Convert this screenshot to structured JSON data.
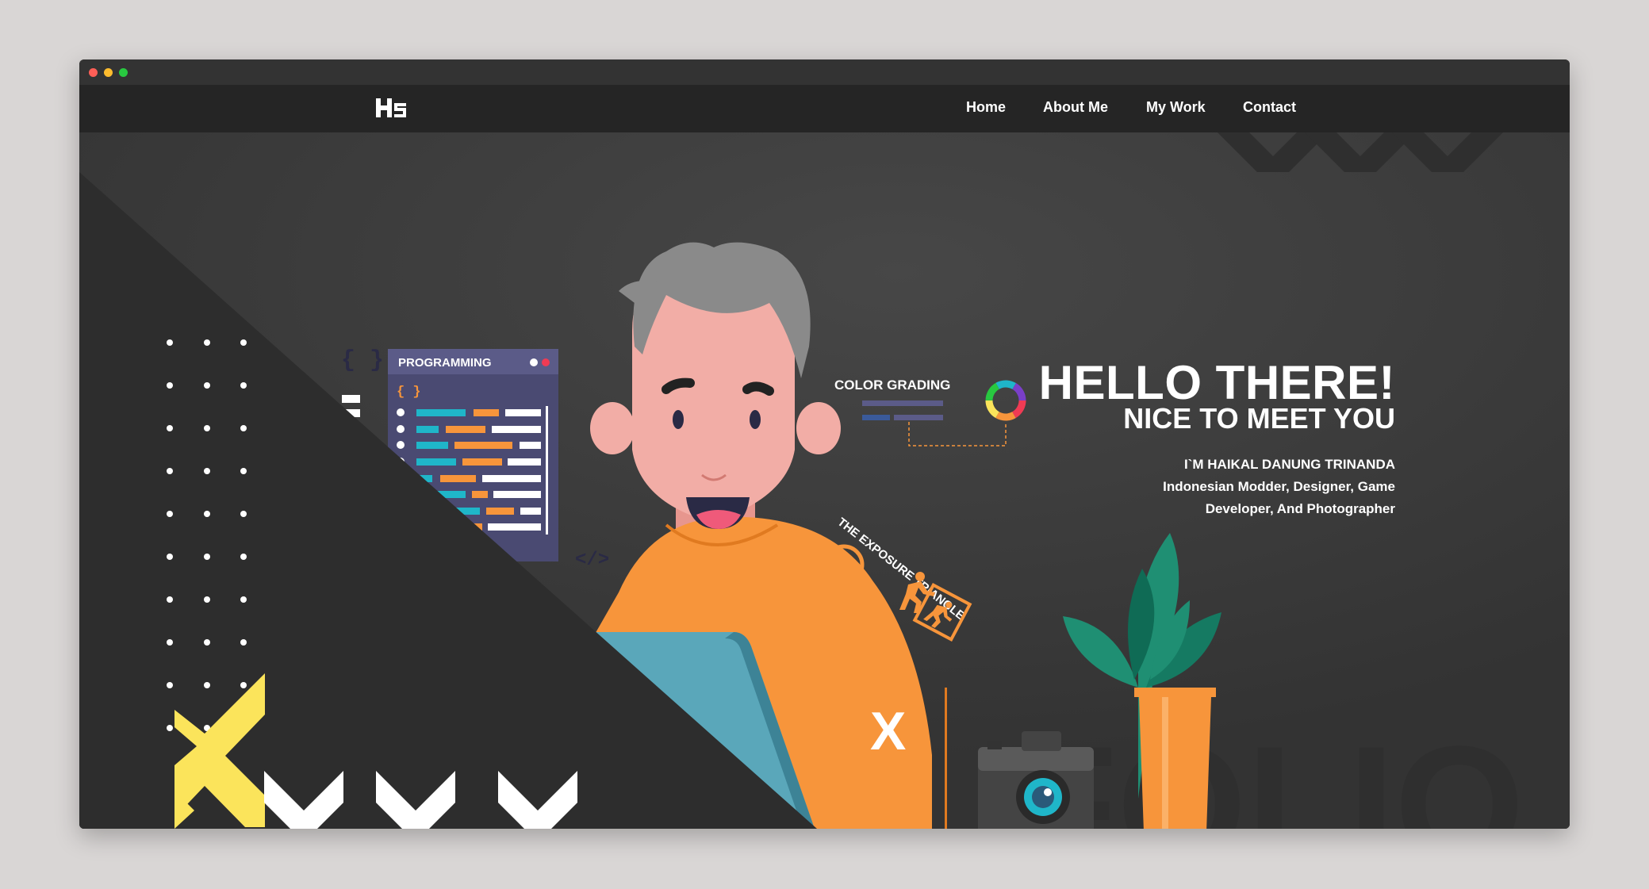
{
  "window": {
    "traffic_lights": [
      "#ff5f57",
      "#febc2e",
      "#28c840"
    ]
  },
  "nav": {
    "logo_icon": "hs-monogram-logo",
    "items": [
      {
        "label": "Home"
      },
      {
        "label": "About Me"
      },
      {
        "label": "My Work"
      },
      {
        "label": "Contact"
      }
    ]
  },
  "hero": {
    "title": "HELLO THERE!",
    "subtitle": "NICE TO MEET YOU",
    "intro_name": "I`M HAIKAL DANUNG TRINANDA",
    "intro_line1": "Indonesian Modder, Designer, Game",
    "intro_line2": "Developer, And Photographer",
    "programming_label": "PROGRAMMING",
    "programming_braces": "{ }",
    "code_tag": "</>",
    "braces_big": "{ }",
    "color_grading_label": "COLOR GRADING",
    "exposure_label": "THE EXPOSURE TRIANGLE",
    "shirt_logo": "X",
    "bg_word": "FOLIO"
  },
  "colors": {
    "background": "#363636",
    "navbar": "#252525",
    "shirt": "#f7953b",
    "laptop": "#5aa7ba",
    "panel": "#4a4a72",
    "accent_yellow": "#fbe45b",
    "plant": "#1f8f73"
  },
  "icons": [
    "chevron-down-icon",
    "aperture-icon",
    "color-wheel-icon",
    "camera-icon",
    "running-person-icon"
  ]
}
